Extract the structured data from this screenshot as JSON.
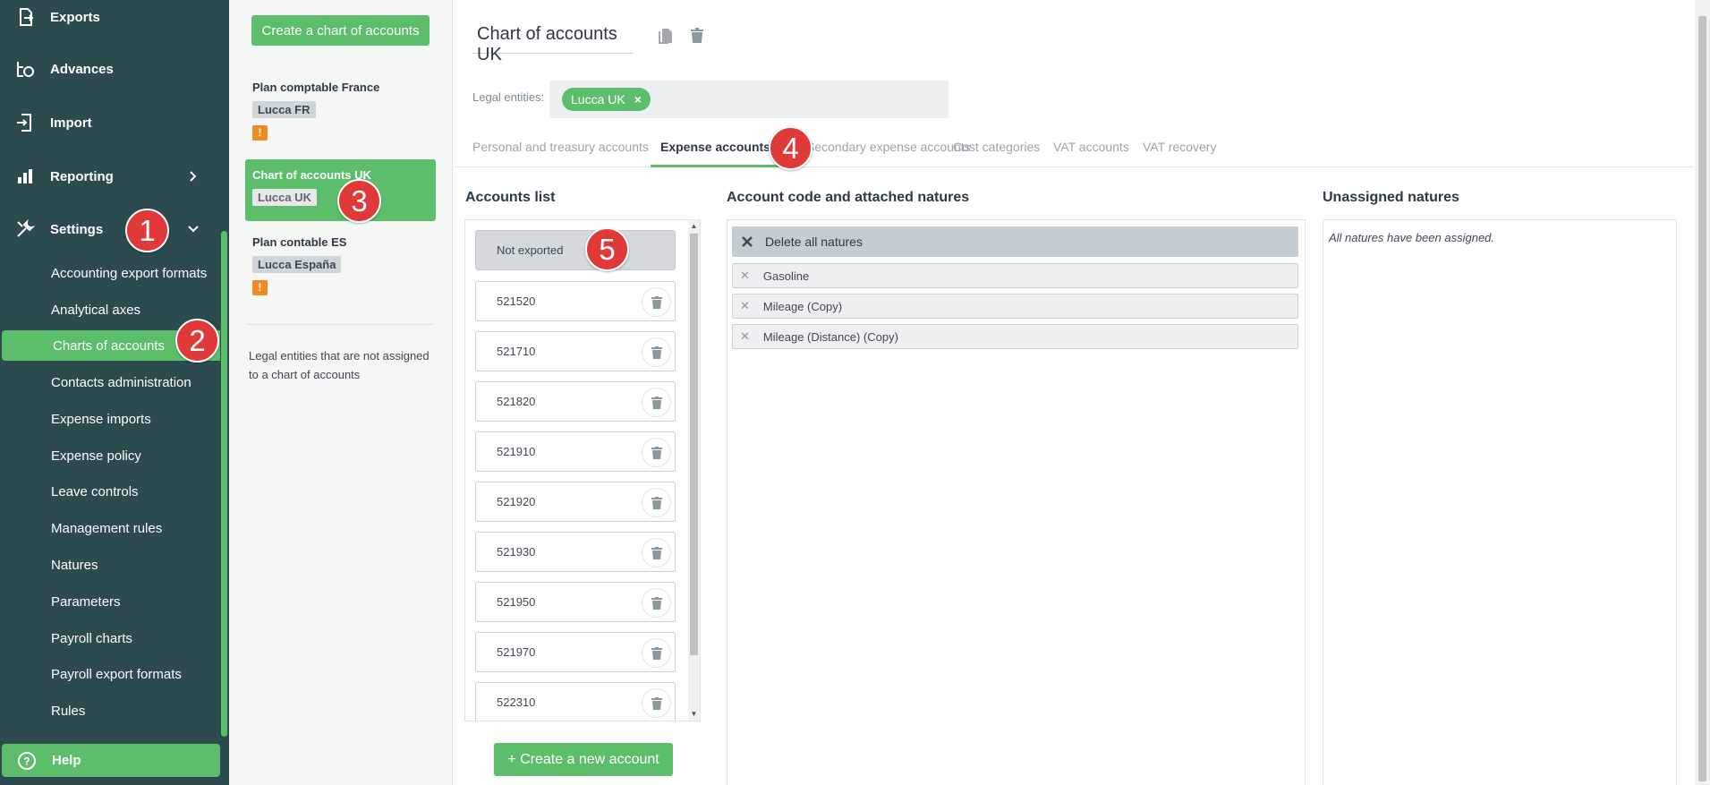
{
  "sidebar": {
    "items": [
      {
        "label": "Exports",
        "icon": "export-icon"
      },
      {
        "label": "Advances",
        "icon": "advances-icon"
      },
      {
        "label": "Import",
        "icon": "import-icon"
      },
      {
        "label": "Reporting",
        "icon": "reporting-icon"
      },
      {
        "label": "Settings",
        "icon": "settings-icon"
      }
    ],
    "settings_subitems": [
      "Accounting export formats",
      "Analytical axes",
      "Charts of accounts",
      "Contacts administration",
      "Expense imports",
      "Expense policy",
      "Leave controls",
      "Management rules",
      "Natures",
      "Parameters",
      "Payroll charts",
      "Payroll export formats",
      "Rules"
    ],
    "help_label": "Help"
  },
  "charts_panel": {
    "create_label": "Create a chart of accounts",
    "charts": [
      {
        "name": "Plan comptable France",
        "entity": "Lucca FR",
        "warning": "!"
      },
      {
        "name": "Chart of accounts UK",
        "entity": "Lucca UK"
      },
      {
        "name": "Plan contable ES",
        "entity": "Lucca España",
        "warning": "!"
      }
    ],
    "unassigned_note": "Legal entities that are not assigned to a chart of accounts"
  },
  "main": {
    "title": "Chart of accounts UK",
    "legal_entities_label": "Legal entities:",
    "legal_entities": [
      {
        "label": "Lucca UK",
        "remove": "×"
      }
    ],
    "tabs": [
      "Personal and treasury accounts",
      "Expense accounts",
      "Secondary expense accounts",
      "Cost categories",
      "VAT accounts",
      "VAT recovery"
    ],
    "accounts_list_title": "Accounts list",
    "not_exported_label": "Not exported",
    "accounts": [
      "521520",
      "521710",
      "521820",
      "521910",
      "521920",
      "521930",
      "521950",
      "521970",
      "522310"
    ],
    "create_account_label": "+ Create a new account",
    "natures_title": "Account code and attached natures",
    "delete_all_label": "Delete all natures",
    "natures": [
      "Gasoline",
      "Mileage (Copy)",
      "Mileage (Distance) (Copy)"
    ],
    "unassigned_title": "Unassigned natures",
    "unassigned_message": "All natures have been assigned."
  },
  "annotations": [
    "1",
    "2",
    "3",
    "4",
    "5"
  ],
  "colors": {
    "sidebar": "#2b4b4f",
    "accent": "#5cbd6a",
    "badge": "#e0393a",
    "warning": "#f08a24"
  }
}
